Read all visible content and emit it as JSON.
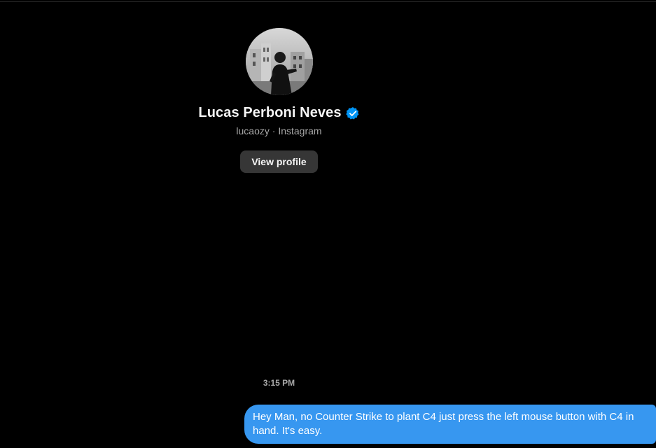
{
  "profile": {
    "name": "Lucas Perboni Neves",
    "username": "lucaozy",
    "separator": " · ",
    "platform": "Instagram",
    "view_profile_label": "View profile",
    "verified": true
  },
  "conversation": {
    "timestamp": "3:15 PM",
    "messages": [
      {
        "sender": "me",
        "text": "Hey Man, no Counter Strike to plant C4 just press the left mouse button with C4 in hand. It's easy."
      }
    ]
  },
  "colors": {
    "background": "#000000",
    "bubble_outgoing": "#3797f0",
    "button_bg": "#363636",
    "verified_badge": "#0095f6",
    "secondary_text": "#a8a8a8"
  },
  "icons": {
    "verified": "verified-badge-icon"
  }
}
